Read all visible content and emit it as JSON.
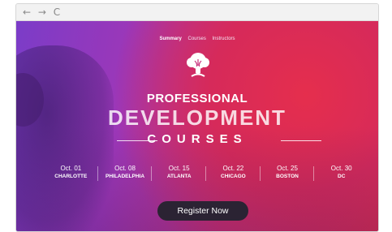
{
  "browser": {
    "back_icon": "←",
    "forward_icon": "→",
    "reload_icon": "C"
  },
  "nav": {
    "items": [
      {
        "label": "Summary"
      },
      {
        "label": "Courses"
      },
      {
        "label": "Instructors"
      }
    ]
  },
  "headline": {
    "line1": "PROFESSIONAL",
    "line2": "DEVELOPMENT",
    "line3": "COURSES"
  },
  "schedule": [
    {
      "date": "Oct. 01",
      "city": "CHARLOTTE"
    },
    {
      "date": "Oct. 08",
      "city": "PHILADELPHIA"
    },
    {
      "date": "Oct. 15",
      "city": "ATLANTA"
    },
    {
      "date": "Oct. 22",
      "city": "CHICAGO"
    },
    {
      "date": "Oct. 25",
      "city": "BOSTON"
    },
    {
      "date": "Oct. 30",
      "city": "DC"
    }
  ],
  "cta": {
    "label": "Register Now"
  },
  "colors": {
    "accent": "#e42f48",
    "purple": "#7b3cc8",
    "button": "#2b2333"
  }
}
